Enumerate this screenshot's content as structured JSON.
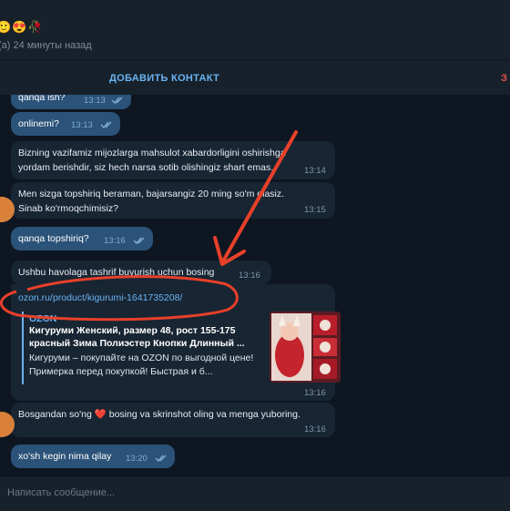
{
  "header": {
    "title_emojis": "🙂😍🥀",
    "status": "(а) 24 минуты назад"
  },
  "actions": {
    "add_contact": "ДОБАВИТЬ КОНТАКТ",
    "block_partial": "З"
  },
  "messages": [
    {
      "id": "m1",
      "dir": "out",
      "text": "qanqa ish?",
      "time": "13:13",
      "read": true
    },
    {
      "id": "m2",
      "dir": "out",
      "text": "onlinemi?",
      "time": "13:13",
      "read": true
    },
    {
      "id": "m3",
      "dir": "in",
      "text": "Bizning vazifamiz mijozlarga mahsulot xabardorligini oshirishga yordam berishdir, siz hech narsa sotib olishingiz shart emas.",
      "time": "13:14"
    },
    {
      "id": "m4",
      "dir": "in",
      "text": "Men sizga topshiriq beraman, bajarsangiz 20 ming so'm olasiz. Sinab ko'rmoqchimisiz?",
      "time": "13:15"
    },
    {
      "id": "m5",
      "dir": "out",
      "text": "qanqa topshiriq?",
      "time": "13:16",
      "read": true
    },
    {
      "id": "m6",
      "dir": "in",
      "text": "Ushbu havolaga tashrif buyurish uchun bosing",
      "time": "13:16"
    },
    {
      "id": "m7",
      "dir": "in",
      "link": "ozon.ru/product/kigurumi-1641735208/",
      "time": "13:16",
      "preview": {
        "site": "OZON",
        "title": "Кигуруми Женский, размер 48, рост 155-175 красный Зима Полиэстер Кнопки Длинный ...",
        "description": "Кигуруми – покупайте на OZON по выгодной цене! Примерка перед покупкой! Быстрая и б..."
      }
    },
    {
      "id": "m8",
      "dir": "in",
      "text_before": "Bosgandan so'ng ",
      "text_after": " bosing va skrinshot oling va menga yuboring.",
      "heart": "❤️",
      "time": "13:16"
    },
    {
      "id": "m9",
      "dir": "out",
      "text": "xo'sh kegin nima qilay",
      "time": "13:20",
      "read": true
    }
  ],
  "input": {
    "placeholder": "Написать сообщение..."
  },
  "colors": {
    "background": "#0e1621",
    "panel": "#17212b",
    "outgoing_bubble": "#2b5278",
    "incoming_bubble": "#182533",
    "accent": "#6ab3f3",
    "annotation": "#e8402a"
  },
  "icons": [
    "double-check-icon",
    "heart-emoji",
    "avatar"
  ]
}
